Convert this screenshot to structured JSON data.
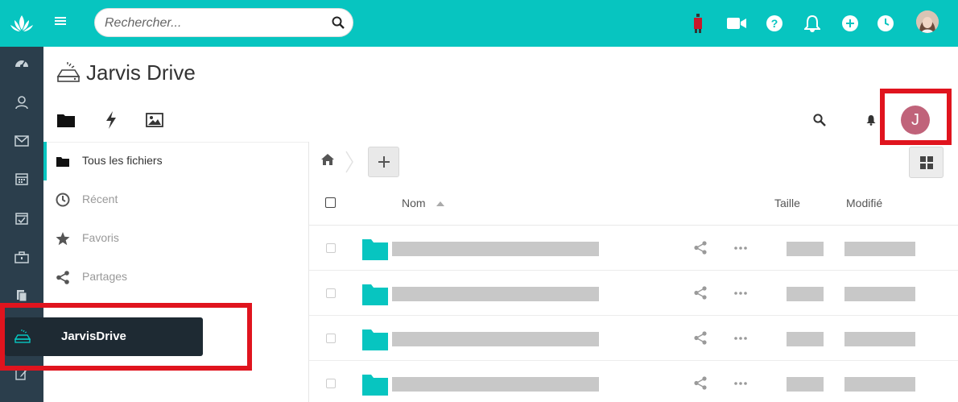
{
  "search": {
    "placeholder": "Rechercher..."
  },
  "app": {
    "title": "Jarvis Drive"
  },
  "user": {
    "initial": "J",
    "avatar_color": "#c0637a"
  },
  "nav": {
    "items": [
      {
        "label": "Tous les fichiers",
        "icon": "folder-icon"
      },
      {
        "label": "Récent",
        "icon": "clock-icon"
      },
      {
        "label": "Favoris",
        "icon": "star-icon"
      },
      {
        "label": "Partages",
        "icon": "share-icon"
      }
    ]
  },
  "tooltip": {
    "label": "JarvisDrive"
  },
  "table": {
    "headers": {
      "name": "Nom",
      "size": "Taille",
      "modified": "Modifié"
    },
    "rows": [
      {
        "type": "folder"
      },
      {
        "type": "folder"
      },
      {
        "type": "folder"
      },
      {
        "type": "folder"
      }
    ]
  },
  "colors": {
    "accent": "#07c5c0",
    "rail": "#2b3e4c",
    "highlight": "#e0141e"
  }
}
